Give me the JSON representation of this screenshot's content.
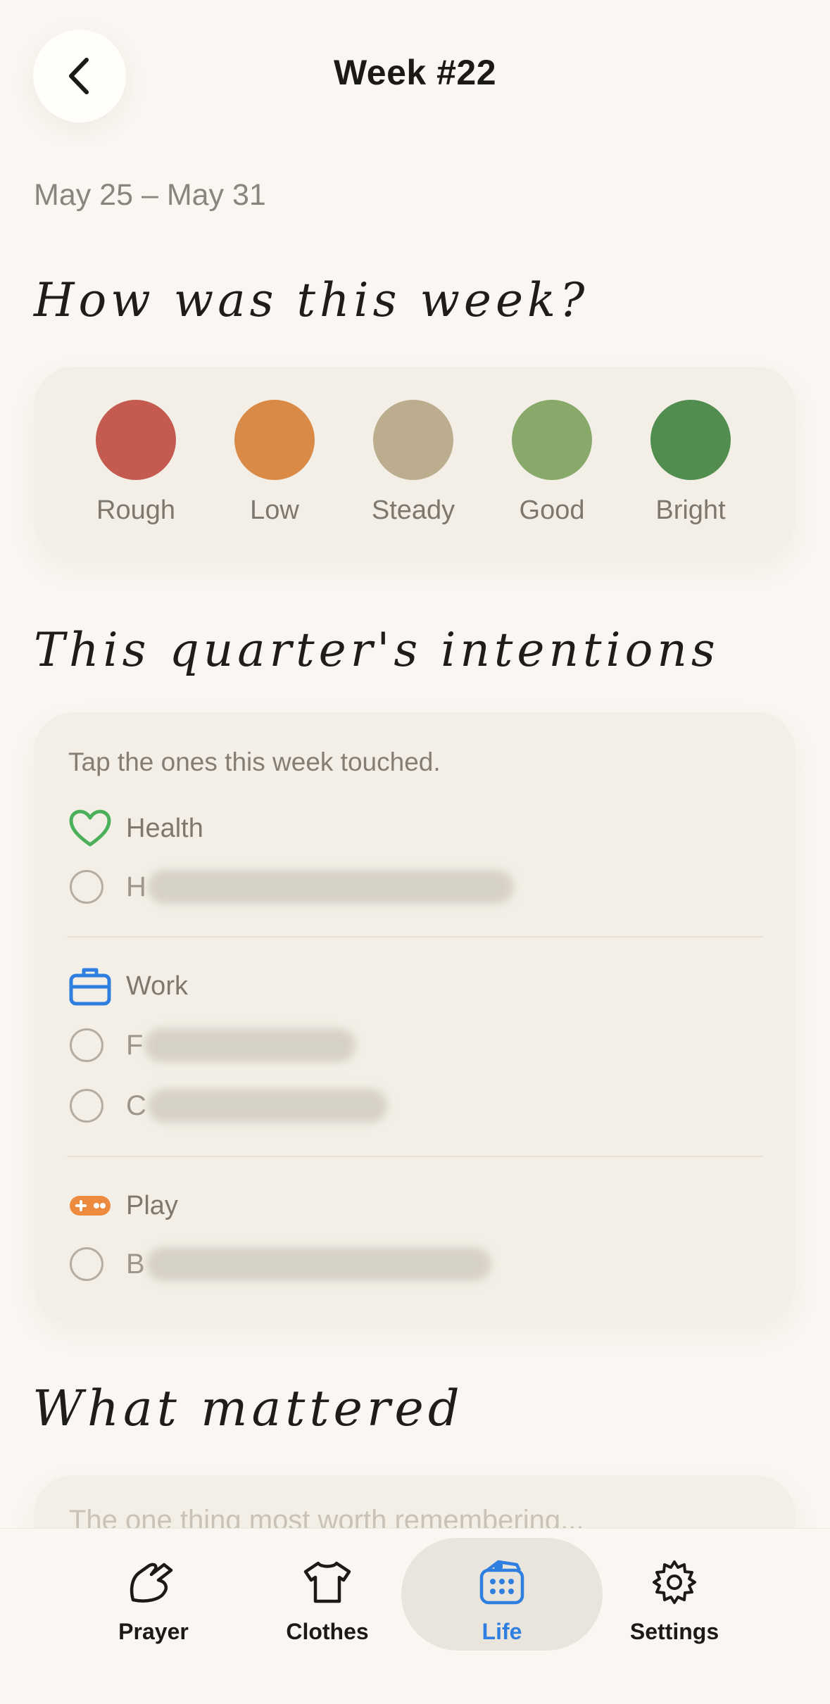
{
  "header": {
    "title": "Week #22",
    "back": "back"
  },
  "date_range": "May 25 – May 31",
  "mood_section": {
    "heading": "How was this week?",
    "options": [
      {
        "label": "Rough",
        "color": "#c55b50"
      },
      {
        "label": "Low",
        "color": "#d98a47"
      },
      {
        "label": "Steady",
        "color": "#bbad8d"
      },
      {
        "label": "Good",
        "color": "#88a96a"
      },
      {
        "label": "Bright",
        "color": "#508d4f"
      }
    ]
  },
  "intentions": {
    "heading": "This quarter's intentions",
    "hint": "Tap the ones this week touched.",
    "groups": [
      {
        "name": "Health",
        "icon": "heart-icon",
        "color": "#4caf5a",
        "items": [
          {
            "initial": "H"
          }
        ]
      },
      {
        "name": "Work",
        "icon": "briefcase-icon",
        "color": "#2f7fe0",
        "items": [
          {
            "initial": "F"
          },
          {
            "initial": "C"
          }
        ]
      },
      {
        "name": "Play",
        "icon": "gamepad-icon",
        "color": "#ec8a3e",
        "items": [
          {
            "initial": "B"
          }
        ]
      }
    ]
  },
  "mattered": {
    "heading": "What mattered",
    "placeholder": "The one thing most worth remembering..."
  },
  "tabbar": {
    "tabs": [
      {
        "label": "Prayer",
        "icon": "prayer-hand-icon"
      },
      {
        "label": "Clothes",
        "icon": "shirt-icon"
      },
      {
        "label": "Life",
        "icon": "life-icon",
        "active": true
      },
      {
        "label": "Settings",
        "icon": "gear-icon"
      }
    ],
    "accent": "#2f7fe0"
  }
}
